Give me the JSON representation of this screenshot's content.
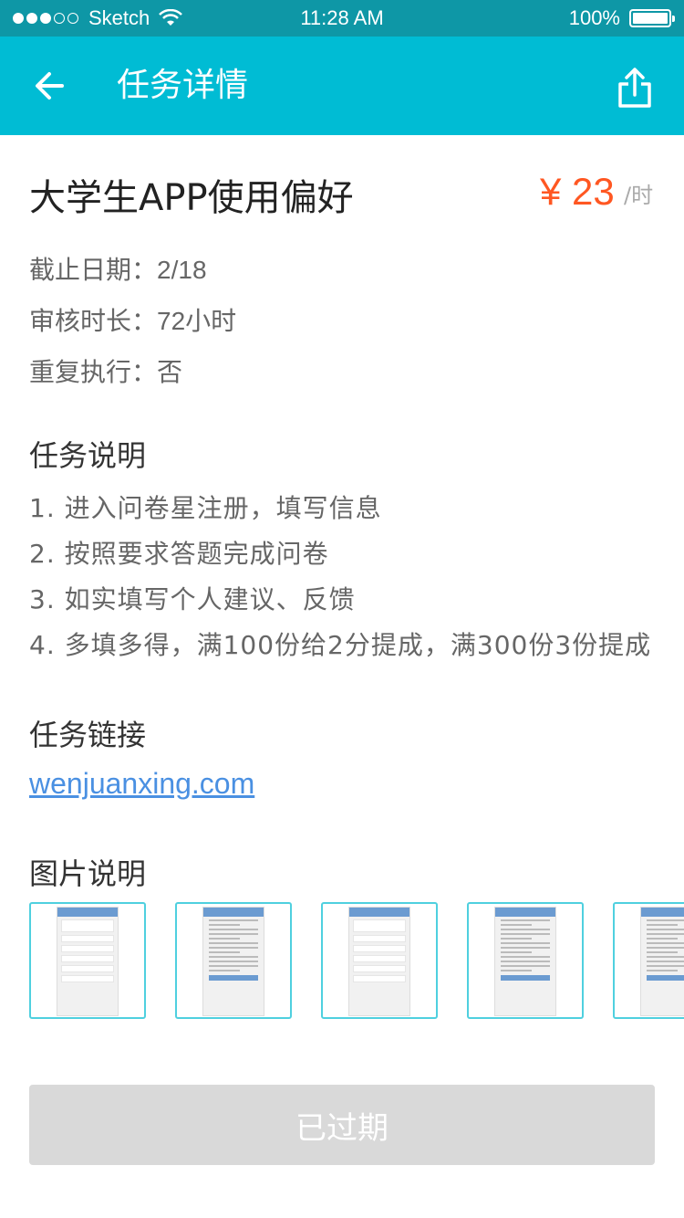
{
  "status_bar": {
    "carrier": "Sketch",
    "time": "11:28 AM",
    "battery_percent": "100%",
    "signal_bars_filled": 3,
    "signal_bars_total": 5
  },
  "nav": {
    "title": "任务详情",
    "back_icon": "arrow-left-icon",
    "share_icon": "share-icon"
  },
  "task": {
    "title": "大学生APP使用偏好",
    "price": "¥ 23",
    "price_unit": "/时",
    "info": [
      {
        "label": "截止日期：",
        "value": "2/18"
      },
      {
        "label": "审核时长：",
        "value": "72小时"
      },
      {
        "label": "重复执行：",
        "value": "否"
      }
    ]
  },
  "description": {
    "title": "任务说明",
    "items": [
      "1. 进入问卷星注册，填写信息",
      "2. 按照要求答题完成问卷",
      "3. 如实填写个人建议、反馈",
      "4. 多填多得，满100份给2分提成，满300份3份提成"
    ]
  },
  "link_section": {
    "title": "任务链接",
    "url": "wenjuanxing.com"
  },
  "images_section": {
    "title": "图片说明",
    "thumbnails": [
      "screenshot-list-icon",
      "screenshot-article-icon",
      "screenshot-list-icon",
      "screenshot-article-icon",
      "screenshot-article-icon"
    ]
  },
  "action": {
    "label": "已过期",
    "enabled": false
  },
  "colors": {
    "status_bar": "#0e97a6",
    "nav_bar": "#00bcd4",
    "price": "#ff5722",
    "link": "#4a90e2",
    "thumb_border": "#4fd0df",
    "disabled_button": "#d9d9d9"
  }
}
